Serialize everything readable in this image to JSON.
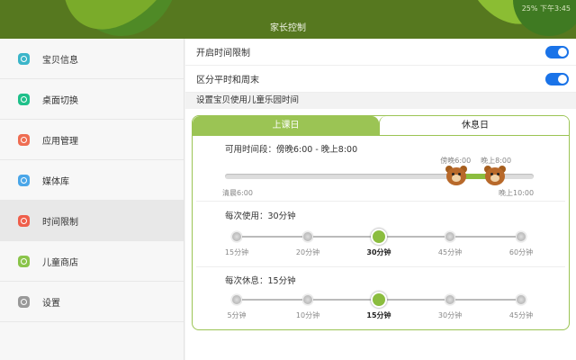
{
  "header": {
    "title": "家长控制",
    "status": "25%  下午3:45"
  },
  "colors": {
    "header": "#56781f",
    "accent": "#9bc454",
    "toggle": "#1a73e8"
  },
  "sidebar": {
    "items": [
      {
        "label": "宝贝信息",
        "icon": "baby-info-icon",
        "color": "#3bb5c9"
      },
      {
        "label": "桌面切换",
        "icon": "desktop-switch-icon",
        "color": "#1fc08a"
      },
      {
        "label": "应用管理",
        "icon": "app-manage-icon",
        "color": "#ee6d52"
      },
      {
        "label": "媒体库",
        "icon": "media-library-icon",
        "color": "#4aa6e8"
      },
      {
        "label": "时间限制",
        "icon": "clock-icon",
        "color": "#ef5f4b",
        "active": true
      },
      {
        "label": "儿童商店",
        "icon": "store-icon",
        "color": "#8ac44a"
      },
      {
        "label": "设置",
        "icon": "gear-icon",
        "color": "#999999"
      }
    ]
  },
  "main": {
    "enable_limit": {
      "label": "开启时间限制",
      "on": true
    },
    "distinguish": {
      "label": "区分平时和周末",
      "on": true
    },
    "sublabel": "设置宝贝使用儿童乐园时间",
    "tabs": [
      {
        "label": "上课日",
        "active": true
      },
      {
        "label": "休息日",
        "active": false
      }
    ],
    "range": {
      "label": "可用时间段：傍晚6:00 - 晚上8:00",
      "min_label": "清晨6:00",
      "max_label": "晚上10:00",
      "min": 6,
      "max": 22,
      "start": 18,
      "end": 20,
      "start_label": "傍晚6:00",
      "end_label": "晚上8:00"
    },
    "use": {
      "label": "每次使用：30分钟",
      "options": [
        "15分钟",
        "20分钟",
        "30分钟",
        "45分钟",
        "60分钟"
      ],
      "selected": 2
    },
    "rest": {
      "label": "每次休息：15分钟",
      "options": [
        "5分钟",
        "10分钟",
        "15分钟",
        "30分钟",
        "45分钟"
      ],
      "selected": 2
    }
  }
}
